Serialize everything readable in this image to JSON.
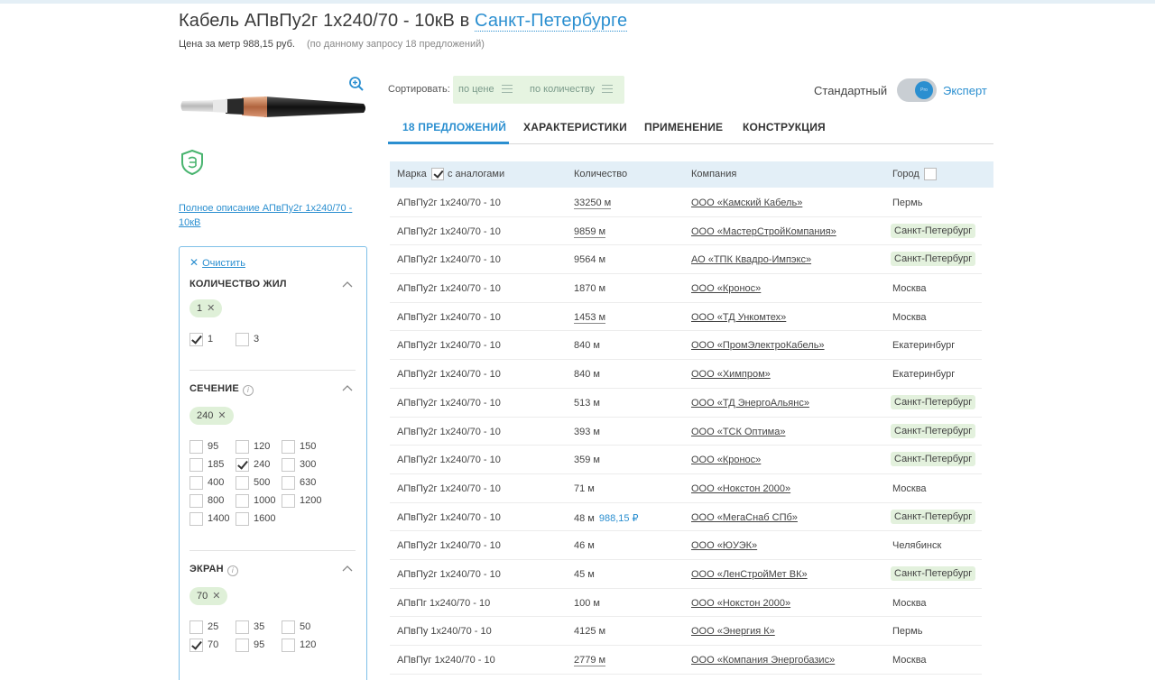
{
  "header": {
    "title_prefix": "Кабель АПвПу2г 1х240/70 - 10кВ в",
    "city": "Санкт-Петербурге",
    "price_text": "Цена за метр 988,15 руб.",
    "offers_note": "(по данному запросу 18 предложений)"
  },
  "product": {
    "full_description_link": "Полное описание АПвПу2г 1х240/70 - 10кВ"
  },
  "filters": {
    "clear_label": "Очистить",
    "sections": [
      {
        "title": "КОЛИЧЕСТВО ЖИЛ",
        "chip": "1",
        "options": [
          {
            "label": "1",
            "checked": true
          },
          {
            "label": "3",
            "checked": false
          }
        ]
      },
      {
        "title": "СЕЧЕНИЕ",
        "chip": "240",
        "options": [
          {
            "label": "95",
            "checked": false
          },
          {
            "label": "120",
            "checked": false
          },
          {
            "label": "150",
            "checked": false
          },
          {
            "label": "185",
            "checked": false
          },
          {
            "label": "240",
            "checked": true
          },
          {
            "label": "300",
            "checked": false
          },
          {
            "label": "400",
            "checked": false
          },
          {
            "label": "500",
            "checked": false
          },
          {
            "label": "630",
            "checked": false
          },
          {
            "label": "800",
            "checked": false
          },
          {
            "label": "1000",
            "checked": false
          },
          {
            "label": "1200",
            "checked": false
          },
          {
            "label": "1400",
            "checked": false
          },
          {
            "label": "1600",
            "checked": false
          }
        ]
      },
      {
        "title": "ЭКРАН",
        "chip": "70",
        "options": [
          {
            "label": "25",
            "checked": false
          },
          {
            "label": "35",
            "checked": false
          },
          {
            "label": "50",
            "checked": false
          },
          {
            "label": "70",
            "checked": true
          },
          {
            "label": "95",
            "checked": false
          },
          {
            "label": "120",
            "checked": false
          }
        ]
      }
    ]
  },
  "sort": {
    "label": "Сортировать:",
    "by_price": "по цене",
    "by_quantity": "по количеству"
  },
  "mode": {
    "standard": "Стандартный",
    "expert": "Эксперт",
    "knob_text": "Pro"
  },
  "tabs": [
    "18 ПРЕДЛОЖЕНИЙ",
    "ХАРАКТЕРИСТИКИ",
    "ПРИМЕНЕНИЕ",
    "КОНСТРУКЦИЯ"
  ],
  "table": {
    "headers": {
      "mark": "Марка",
      "analogs": "с аналогами",
      "quantity": "Количество",
      "company": "Компания",
      "city": "Город"
    },
    "rows": [
      {
        "mark": "АПвПу2г 1х240/70 - 10",
        "qty": "33250 м",
        "qty_dotted": true,
        "price": "",
        "company": "ООО «Камский Кабель»",
        "city": "Пермь",
        "city_badge": false
      },
      {
        "mark": "АПвПу2г 1х240/70 - 10",
        "qty": "9859 м",
        "qty_dotted": true,
        "price": "",
        "company": "ООО «МастерСтройКомпания»",
        "city": "Санкт-Петербург",
        "city_badge": true
      },
      {
        "mark": "АПвПу2г 1х240/70 - 10",
        "qty": "9564 м",
        "qty_dotted": false,
        "price": "",
        "company": "АО «ТПК Квадро-Импэкс»",
        "city": "Санкт-Петербург",
        "city_badge": true
      },
      {
        "mark": "АПвПу2г 1х240/70 - 10",
        "qty": "1870 м",
        "qty_dotted": false,
        "price": "",
        "company": "ООО «Кронос»",
        "city": "Москва",
        "city_badge": false
      },
      {
        "mark": "АПвПу2г 1х240/70 - 10",
        "qty": "1453 м",
        "qty_dotted": true,
        "price": "",
        "company": "ООО «ТД Ункомтех»",
        "city": "Москва",
        "city_badge": false
      },
      {
        "mark": "АПвПу2г 1х240/70 - 10",
        "qty": "840 м",
        "qty_dotted": false,
        "price": "",
        "company": "ООО «ПромЭлектроКабель»",
        "city": "Екатеринбург",
        "city_badge": false
      },
      {
        "mark": "АПвПу2г 1х240/70 - 10",
        "qty": "840 м",
        "qty_dotted": false,
        "price": "",
        "company": "ООО «Химпром»",
        "city": "Екатеринбург",
        "city_badge": false
      },
      {
        "mark": "АПвПу2г 1х240/70 - 10",
        "qty": "513 м",
        "qty_dotted": false,
        "price": "",
        "company": "ООО «ТД ЭнергоАльянс»",
        "city": "Санкт-Петербург",
        "city_badge": true
      },
      {
        "mark": "АПвПу2г 1х240/70 - 10",
        "qty": "393 м",
        "qty_dotted": false,
        "price": "",
        "company": "ООО «ТСК Оптима»",
        "city": "Санкт-Петербург",
        "city_badge": true
      },
      {
        "mark": "АПвПу2г 1х240/70 - 10",
        "qty": "359 м",
        "qty_dotted": false,
        "price": "",
        "company": "ООО «Кронос»",
        "city": "Санкт-Петербург",
        "city_badge": true
      },
      {
        "mark": "АПвПу2г 1х240/70 - 10",
        "qty": "71 м",
        "qty_dotted": false,
        "price": "",
        "company": "ООО «Нокстон 2000»",
        "city": "Москва",
        "city_badge": false
      },
      {
        "mark": "АПвПу2г 1х240/70 - 10",
        "qty": "48 м",
        "qty_dotted": false,
        "price": "988,15 ₽",
        "company": "ООО «МегаСнаб СПб»",
        "city": "Санкт-Петербург",
        "city_badge": true
      },
      {
        "mark": "АПвПу2г 1х240/70 - 10",
        "qty": "46 м",
        "qty_dotted": false,
        "price": "",
        "company": "ООО «ЮУЭК»",
        "city": "Челябинск",
        "city_badge": false
      },
      {
        "mark": "АПвПу2г 1х240/70 - 10",
        "qty": "45 м",
        "qty_dotted": false,
        "price": "",
        "company": "ООО «ЛенСтройМет ВК»",
        "city": "Санкт-Петербург",
        "city_badge": true
      },
      {
        "mark": "АПвПг 1х240/70 - 10",
        "qty": "100 м",
        "qty_dotted": false,
        "price": "",
        "company": "ООО «Нокстон 2000»",
        "city": "Москва",
        "city_badge": false
      },
      {
        "mark": "АПвПу 1х240/70 - 10",
        "qty": "4125 м",
        "qty_dotted": false,
        "price": "",
        "company": "ООО «Энергия К»",
        "city": "Пермь",
        "city_badge": false
      },
      {
        "mark": "АПвПуг 1х240/70 - 10",
        "qty": "2779 м",
        "qty_dotted": true,
        "price": "",
        "company": "ООО «Компания Энергобазис»",
        "city": "Москва",
        "city_badge": false
      }
    ]
  },
  "colors": {
    "accent": "#2b8fd0",
    "chip_bg": "#dff0d8",
    "table_header_bg": "#e3eff7",
    "city_badge_bg": "#e3f1dd"
  }
}
